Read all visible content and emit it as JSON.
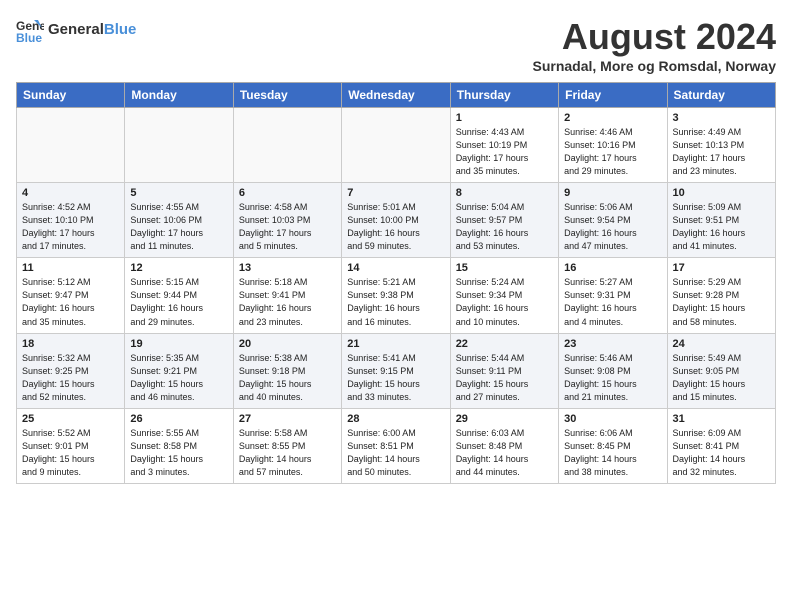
{
  "logo": {
    "general": "General",
    "blue": "Blue"
  },
  "title": "August 2024",
  "subtitle": "Surnadal, More og Romsdal, Norway",
  "weekdays": [
    "Sunday",
    "Monday",
    "Tuesday",
    "Wednesday",
    "Thursday",
    "Friday",
    "Saturday"
  ],
  "weeks": [
    [
      {
        "day": "",
        "info": ""
      },
      {
        "day": "",
        "info": ""
      },
      {
        "day": "",
        "info": ""
      },
      {
        "day": "",
        "info": ""
      },
      {
        "day": "1",
        "info": "Sunrise: 4:43 AM\nSunset: 10:19 PM\nDaylight: 17 hours\nand 35 minutes."
      },
      {
        "day": "2",
        "info": "Sunrise: 4:46 AM\nSunset: 10:16 PM\nDaylight: 17 hours\nand 29 minutes."
      },
      {
        "day": "3",
        "info": "Sunrise: 4:49 AM\nSunset: 10:13 PM\nDaylight: 17 hours\nand 23 minutes."
      }
    ],
    [
      {
        "day": "4",
        "info": "Sunrise: 4:52 AM\nSunset: 10:10 PM\nDaylight: 17 hours\nand 17 minutes."
      },
      {
        "day": "5",
        "info": "Sunrise: 4:55 AM\nSunset: 10:06 PM\nDaylight: 17 hours\nand 11 minutes."
      },
      {
        "day": "6",
        "info": "Sunrise: 4:58 AM\nSunset: 10:03 PM\nDaylight: 17 hours\nand 5 minutes."
      },
      {
        "day": "7",
        "info": "Sunrise: 5:01 AM\nSunset: 10:00 PM\nDaylight: 16 hours\nand 59 minutes."
      },
      {
        "day": "8",
        "info": "Sunrise: 5:04 AM\nSunset: 9:57 PM\nDaylight: 16 hours\nand 53 minutes."
      },
      {
        "day": "9",
        "info": "Sunrise: 5:06 AM\nSunset: 9:54 PM\nDaylight: 16 hours\nand 47 minutes."
      },
      {
        "day": "10",
        "info": "Sunrise: 5:09 AM\nSunset: 9:51 PM\nDaylight: 16 hours\nand 41 minutes."
      }
    ],
    [
      {
        "day": "11",
        "info": "Sunrise: 5:12 AM\nSunset: 9:47 PM\nDaylight: 16 hours\nand 35 minutes."
      },
      {
        "day": "12",
        "info": "Sunrise: 5:15 AM\nSunset: 9:44 PM\nDaylight: 16 hours\nand 29 minutes."
      },
      {
        "day": "13",
        "info": "Sunrise: 5:18 AM\nSunset: 9:41 PM\nDaylight: 16 hours\nand 23 minutes."
      },
      {
        "day": "14",
        "info": "Sunrise: 5:21 AM\nSunset: 9:38 PM\nDaylight: 16 hours\nand 16 minutes."
      },
      {
        "day": "15",
        "info": "Sunrise: 5:24 AM\nSunset: 9:34 PM\nDaylight: 16 hours\nand 10 minutes."
      },
      {
        "day": "16",
        "info": "Sunrise: 5:27 AM\nSunset: 9:31 PM\nDaylight: 16 hours\nand 4 minutes."
      },
      {
        "day": "17",
        "info": "Sunrise: 5:29 AM\nSunset: 9:28 PM\nDaylight: 15 hours\nand 58 minutes."
      }
    ],
    [
      {
        "day": "18",
        "info": "Sunrise: 5:32 AM\nSunset: 9:25 PM\nDaylight: 15 hours\nand 52 minutes."
      },
      {
        "day": "19",
        "info": "Sunrise: 5:35 AM\nSunset: 9:21 PM\nDaylight: 15 hours\nand 46 minutes."
      },
      {
        "day": "20",
        "info": "Sunrise: 5:38 AM\nSunset: 9:18 PM\nDaylight: 15 hours\nand 40 minutes."
      },
      {
        "day": "21",
        "info": "Sunrise: 5:41 AM\nSunset: 9:15 PM\nDaylight: 15 hours\nand 33 minutes."
      },
      {
        "day": "22",
        "info": "Sunrise: 5:44 AM\nSunset: 9:11 PM\nDaylight: 15 hours\nand 27 minutes."
      },
      {
        "day": "23",
        "info": "Sunrise: 5:46 AM\nSunset: 9:08 PM\nDaylight: 15 hours\nand 21 minutes."
      },
      {
        "day": "24",
        "info": "Sunrise: 5:49 AM\nSunset: 9:05 PM\nDaylight: 15 hours\nand 15 minutes."
      }
    ],
    [
      {
        "day": "25",
        "info": "Sunrise: 5:52 AM\nSunset: 9:01 PM\nDaylight: 15 hours\nand 9 minutes."
      },
      {
        "day": "26",
        "info": "Sunrise: 5:55 AM\nSunset: 8:58 PM\nDaylight: 15 hours\nand 3 minutes."
      },
      {
        "day": "27",
        "info": "Sunrise: 5:58 AM\nSunset: 8:55 PM\nDaylight: 14 hours\nand 57 minutes."
      },
      {
        "day": "28",
        "info": "Sunrise: 6:00 AM\nSunset: 8:51 PM\nDaylight: 14 hours\nand 50 minutes."
      },
      {
        "day": "29",
        "info": "Sunrise: 6:03 AM\nSunset: 8:48 PM\nDaylight: 14 hours\nand 44 minutes."
      },
      {
        "day": "30",
        "info": "Sunrise: 6:06 AM\nSunset: 8:45 PM\nDaylight: 14 hours\nand 38 minutes."
      },
      {
        "day": "31",
        "info": "Sunrise: 6:09 AM\nSunset: 8:41 PM\nDaylight: 14 hours\nand 32 minutes."
      }
    ]
  ]
}
